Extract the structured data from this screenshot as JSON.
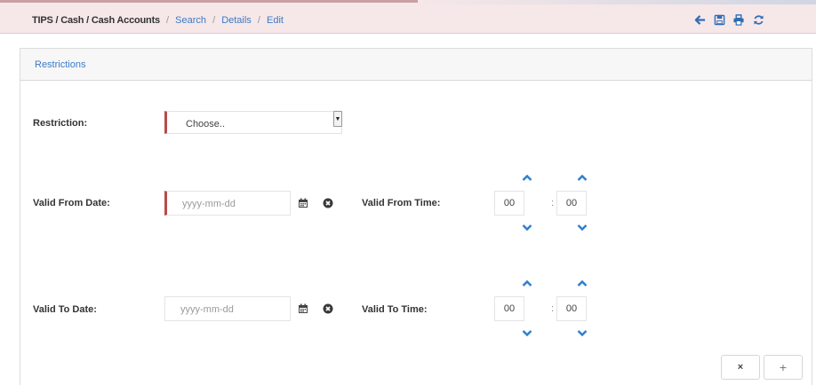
{
  "breadcrumb": {
    "current": "TIPS / Cash / Cash Accounts",
    "separator": "/",
    "links": [
      "Search",
      "Details",
      "Edit"
    ]
  },
  "toolbar": {
    "icons": [
      "arrow-left-icon",
      "save-icon",
      "print-icon",
      "refresh-icon"
    ],
    "accent": "#2f6db5"
  },
  "panel": {
    "title": "Restrictions"
  },
  "form": {
    "restriction": {
      "label": "Restriction:",
      "value": "Choose.."
    },
    "valid_from_date": {
      "label": "Valid From Date:",
      "placeholder": "yyyy-mm-dd"
    },
    "valid_from_time": {
      "label": "Valid From Time:",
      "hours": "00",
      "minutes": "00",
      "separator": ":"
    },
    "valid_to_date": {
      "label": "Valid To Date:",
      "placeholder": "yyyy-mm-dd"
    },
    "valid_to_time": {
      "label": "Valid To Time:",
      "hours": "00",
      "minutes": "00",
      "separator": ":"
    }
  },
  "buttons": {
    "cancel": "×",
    "add": "+"
  },
  "colors": {
    "required_marker": "#b84a4a",
    "link": "#3a7bc8",
    "topbar_bg": "#f6e7e8",
    "arrow": "#2f7fd0"
  }
}
